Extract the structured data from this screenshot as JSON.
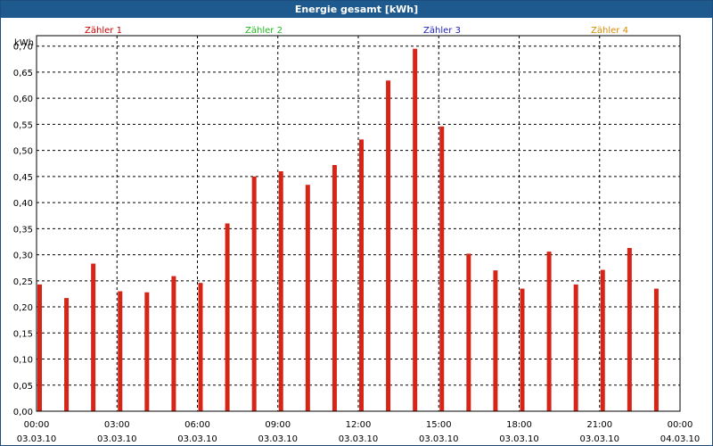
{
  "window": {
    "title": "Energie gesamt [kWh]"
  },
  "colors": {
    "titlebar": "#1f5a8e",
    "bar": "#d62416",
    "grid": "#000000"
  },
  "chart_data": {
    "type": "bar",
    "title": "Energie gesamt [kWh]",
    "ylabel": "kWh",
    "ylim": [
      0,
      0.72
    ],
    "grid": true,
    "legend_position": "top",
    "legend": [
      {
        "name": "Zähler 1",
        "color": "#cc0000"
      },
      {
        "name": "Zähler 2",
        "color": "#22bb22"
      },
      {
        "name": "Zähler 3",
        "color": "#2222bb"
      },
      {
        "name": "Zähler 4",
        "color": "#d88a00"
      }
    ],
    "y_ticks": [
      "0,00",
      "0,05",
      "0,10",
      "0,15",
      "0,20",
      "0,25",
      "0,30",
      "0,35",
      "0,40",
      "0,45",
      "0,50",
      "0,55",
      "0,60",
      "0,65",
      "0,70"
    ],
    "x_ticks": [
      {
        "time": "00:00",
        "date": "03.03.10"
      },
      {
        "time": "03:00",
        "date": "03.03.10"
      },
      {
        "time": "06:00",
        "date": "03.03.10"
      },
      {
        "time": "09:00",
        "date": "03.03.10"
      },
      {
        "time": "12:00",
        "date": "03.03.10"
      },
      {
        "time": "15:00",
        "date": "03.03.10"
      },
      {
        "time": "18:00",
        "date": "03.03.10"
      },
      {
        "time": "21:00",
        "date": "03.03.10"
      },
      {
        "time": "00:00",
        "date": "04.03.10"
      }
    ],
    "x_range_hours": [
      0,
      24
    ],
    "series": [
      {
        "name": "Zähler 1",
        "hours": [
          0,
          1,
          2,
          3,
          4,
          5,
          6,
          7,
          8,
          9,
          10,
          11,
          12,
          13,
          14,
          15,
          16,
          17,
          18,
          19,
          20,
          21,
          22,
          23
        ],
        "values": [
          0.243,
          0.217,
          0.283,
          0.23,
          0.228,
          0.259,
          0.246,
          0.36,
          0.45,
          0.46,
          0.434,
          0.472,
          0.521,
          0.634,
          0.695,
          0.546,
          0.302,
          0.27,
          0.235,
          0.306,
          0.243,
          0.271,
          0.313,
          0.235
        ]
      }
    ]
  }
}
